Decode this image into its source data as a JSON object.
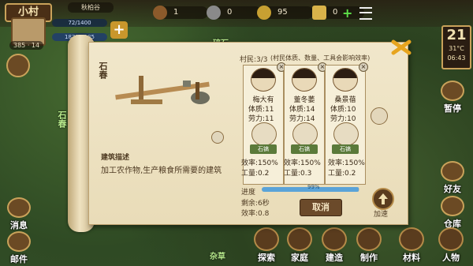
{
  "top": {
    "village_name": "小村",
    "location_name": "秋柏谷",
    "hp_text": "72/1400",
    "exp_text": "1871/2185",
    "stat_a": "385",
    "stat_b": "14",
    "resource_1": "1",
    "resource_2": "0",
    "coins": "95",
    "resource_4": "0"
  },
  "map_labels": {
    "rock": "碎石",
    "grass": "杂草"
  },
  "calendar": {
    "day": "21",
    "temp": "31°C",
    "time": "06:43"
  },
  "side_left": [
    "消息",
    "邮件"
  ],
  "side_right": [
    "暂停",
    "好友",
    "仓库"
  ],
  "bottom_menu": [
    "探索",
    "家庭",
    "建造",
    "制作",
    "材料",
    "人物"
  ],
  "building": {
    "name": "石春",
    "title_short": "石春",
    "desc_label": "建筑描述",
    "desc_text": "加工农作物,生产粮食所需要的建筑",
    "villagers_label": "村民:3/3",
    "villagers_note": "(村民体质、数量、工具会影响效率)",
    "workers": [
      {
        "name": "梅大有",
        "physique": "体质:11",
        "effort": "劳力:11",
        "tool": "石镐",
        "efficiency": "效率:150%",
        "work": "工量:0.2"
      },
      {
        "name": "董冬萎",
        "physique": "体质:14",
        "effort": "劳力:14",
        "tool": "石镐",
        "efficiency": "效率:150%",
        "work": "工量:0.3"
      },
      {
        "name": "桑景蓓",
        "physique": "体质:10",
        "effort": "劳力:10",
        "tool": "石镐",
        "efficiency": "效率:150%",
        "work": "工量:0.2"
      }
    ],
    "progress_label": "进度",
    "progress_value": 0.99,
    "progress_text": "99%",
    "remaining": "剩余:6秒",
    "efficiency_total": "效率:0.8",
    "cancel_label": "取消",
    "accelerate_label": "加速"
  },
  "colors": {
    "parchment": "#f1e7cb",
    "progress": "#5aa3d8",
    "accent": "#e7a51f"
  }
}
